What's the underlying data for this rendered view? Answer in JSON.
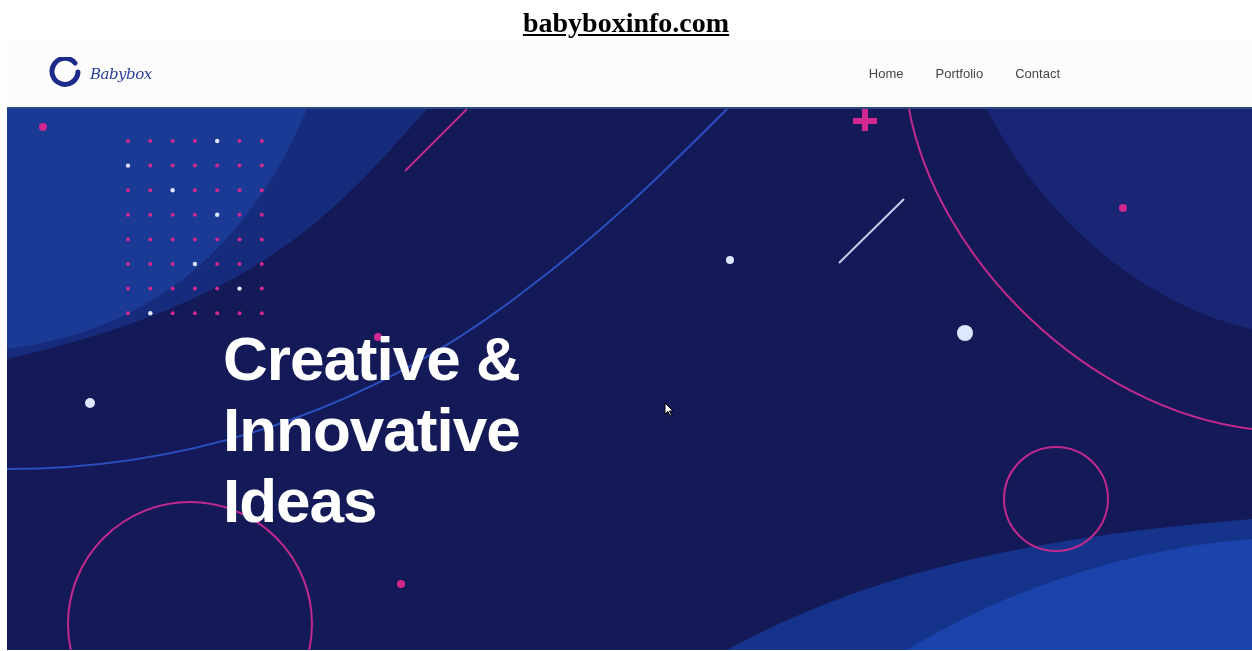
{
  "caption": "babyboxinfo.com",
  "header": {
    "logo_text": "Babybox",
    "nav": [
      {
        "label": "Home"
      },
      {
        "label": "Portfolio"
      },
      {
        "label": "Contact"
      }
    ]
  },
  "hero": {
    "heading_lines": [
      "Creative &",
      "Innovative",
      "Ideas"
    ]
  }
}
